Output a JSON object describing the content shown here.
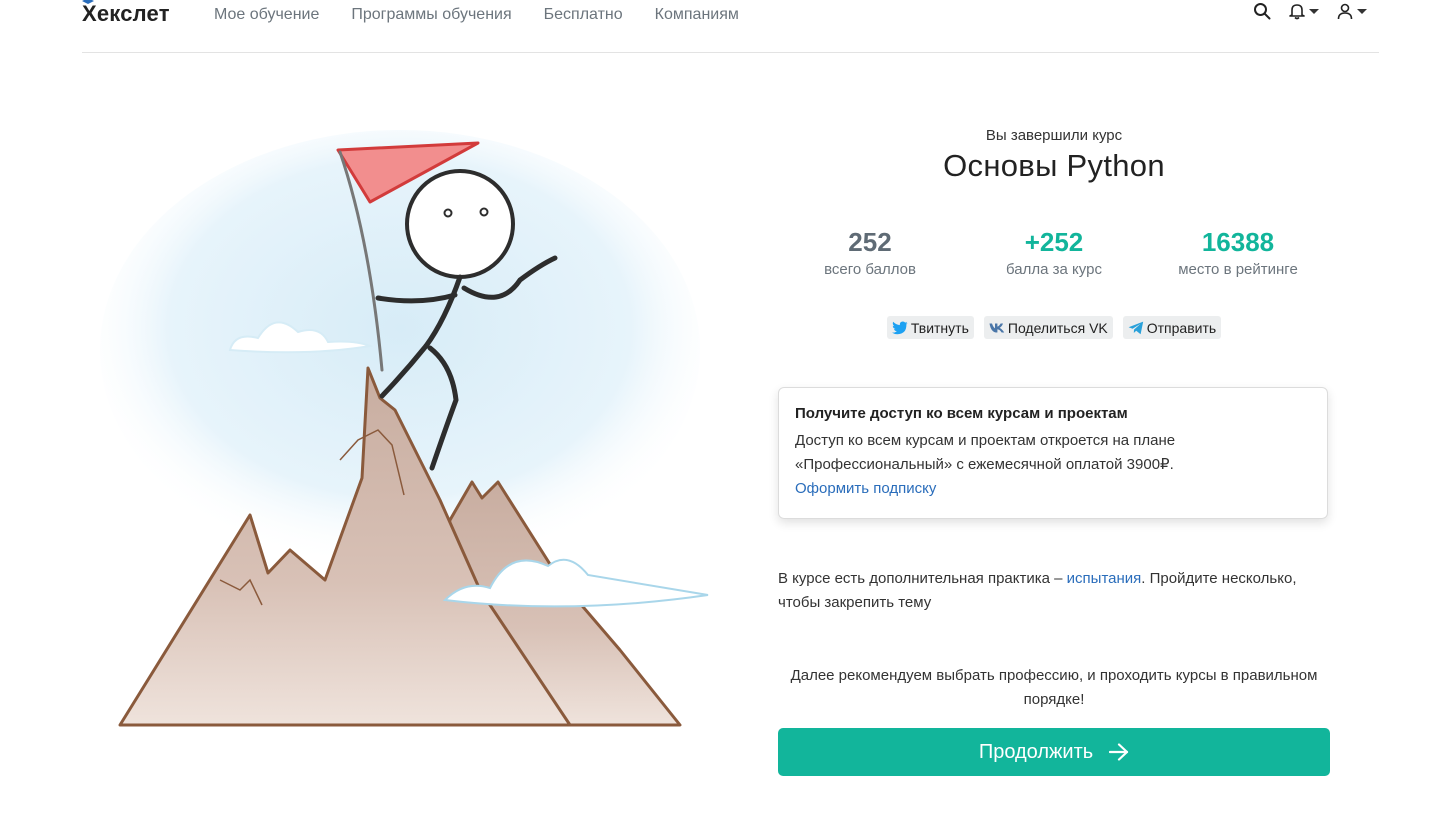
{
  "header": {
    "logo": "Хекслет",
    "nav": [
      "Мое обучение",
      "Программы обучения",
      "Бесплатно",
      "Компаниям"
    ],
    "icons": [
      "search-icon",
      "bell-icon",
      "user-icon"
    ]
  },
  "course": {
    "subtitle": "Вы завершили курс",
    "title": "Основы Python"
  },
  "stats": [
    {
      "value": "252",
      "label": "всего баллов",
      "color": "#5f6b75"
    },
    {
      "value": "+252",
      "label": "балла за курс",
      "color": "#12b59b"
    },
    {
      "value": "16388",
      "label": "место в рейтинге",
      "color": "#12b59b"
    }
  ],
  "share": {
    "twitter": "Твитнуть",
    "vk": "Поделиться VK",
    "telegram": "Отправить"
  },
  "access_card": {
    "title": "Получите доступ ко всем курсам и проектам",
    "text": "Доступ ко всем курсам и проектам откроется на плане «Профессиональный» с ежемесячной оплатой 3900₽.",
    "link": "Оформить подписку"
  },
  "practice": {
    "before": "В курсе есть дополнительная практика – ",
    "link": "испытания",
    "after": ". Пройдите несколько, чтобы закрепить тему"
  },
  "recommendation": "Далее рекомендуем выбрать профессию, и проходить курсы в правильном порядке!",
  "continue_label": "Продолжить",
  "colors": {
    "accent": "#12b59b",
    "link": "#2a6dbb",
    "muted": "#6c757d"
  }
}
